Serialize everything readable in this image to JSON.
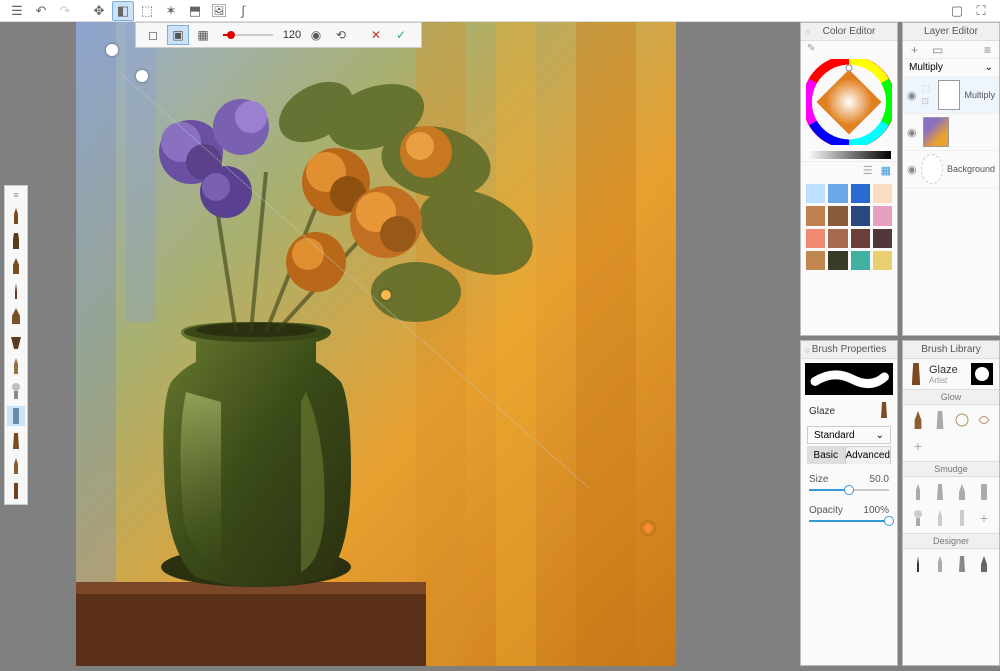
{
  "toolbar": {
    "size_value": "120"
  },
  "colorEditor": {
    "title": "Color Editor",
    "swatches": [
      "#bce0fd",
      "#6aa8e8",
      "#2a6ad0",
      "#f9dcc1",
      "#c08050",
      "#8a5a3a",
      "#2a4880",
      "#e8a0c0",
      "#f08a70",
      "#a86a50",
      "#6a4038",
      "#50383a",
      "#c08850",
      "#3a3a28",
      "#40b0a0",
      "#e8d070"
    ]
  },
  "brushProps": {
    "title": "Brush Properties",
    "name_label": "Glaze",
    "type_label": "Standard",
    "tab_basic": "Basic",
    "tab_advanced": "Advanced",
    "size_label": "Size",
    "size_value": "50.0",
    "opacity_label": "Opacity",
    "opacity_value": "100%"
  },
  "layerEditor": {
    "title": "Layer Editor",
    "blend_mode": "Multiply",
    "layers": [
      {
        "name": "Multiply",
        "visible": true
      },
      {
        "name": "",
        "visible": true
      },
      {
        "name": "Background",
        "visible": true
      }
    ]
  },
  "brushLibrary": {
    "title": "Brush Library",
    "current_name": "Glaze",
    "current_set": "Artist",
    "cat_glow": "Glow",
    "cat_smudge": "Smudge",
    "cat_designer": "Designer"
  }
}
